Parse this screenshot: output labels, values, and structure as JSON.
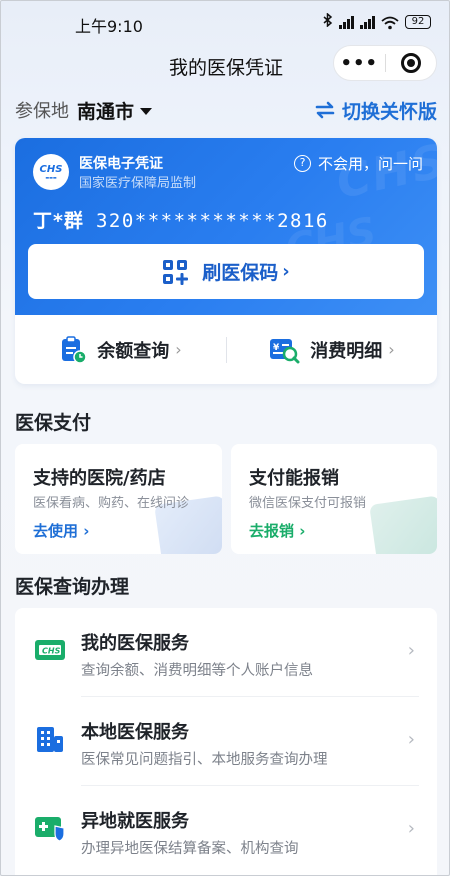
{
  "status_bar": {
    "time": "上午9:10",
    "battery": "92"
  },
  "nav": {
    "title": "我的医保凭证",
    "more": "•••"
  },
  "location": {
    "label": "参保地",
    "city": "南通市",
    "switch_label": "切换关怀版"
  },
  "card": {
    "issuer": "医保电子凭证",
    "issuer_sub": "国家医疗保障局监制",
    "logo_text": "CHS",
    "help": "不会用，问一问",
    "user_name": "丁*群",
    "user_id": "320***********2816",
    "qr_button": "刷医保码",
    "balance": "余额查询",
    "detail": "消费明细"
  },
  "payment": {
    "title": "医保支付",
    "items": [
      {
        "title": "支持的医院/药店",
        "desc": "医保看病、购药、在线问诊",
        "action": "去使用"
      },
      {
        "title": "支付能报销",
        "desc": "微信医保支付可报销",
        "action": "去报销"
      }
    ]
  },
  "services": {
    "title": "医保查询办理",
    "items": [
      {
        "title": "我的医保服务",
        "desc": "查询余额、消费明细等个人账户信息",
        "icon": "chs-card-icon"
      },
      {
        "title": "本地医保服务",
        "desc": "医保常见问题指引、本地服务查询办理",
        "icon": "building-icon"
      },
      {
        "title": "异地就医服务",
        "desc": "办理异地医保结算备案、机构查询",
        "icon": "medical-shield-icon"
      }
    ]
  },
  "colors": {
    "primary": "#1b6ee0",
    "link_blue": "#1f6fd6",
    "green": "#1aad6a"
  }
}
